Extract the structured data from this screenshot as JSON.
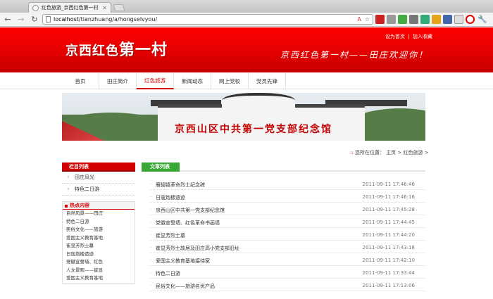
{
  "browser": {
    "tab_title": "红色旅游_京西红色第一村",
    "url_host": "localhost",
    "url_path": "/tianzhuang/a/hongselvyou/"
  },
  "site": {
    "logo_prefix": "京西红色",
    "logo_big": "第一村",
    "slogan": "京西红色第一村——田庄欢迎你！",
    "top_links": [
      "设为首页",
      "|",
      "加入收藏"
    ],
    "nav": [
      "首页",
      "田庄简介",
      "红色旅游",
      "新闻动态",
      "网上党校",
      "党员先锋"
    ],
    "active_nav": "红色旅游",
    "hero_text": "京西山区中共第一党支部纪念馆"
  },
  "breadcrumb": {
    "prefix": "您所在位置：",
    "home": "主页",
    "sep": ">",
    "current": "红色旅游",
    "tail": ">"
  },
  "sidebar": {
    "title": "栏目列表",
    "items": [
      "田庄风光",
      "特色二日游"
    ],
    "hot_title": "热点内容",
    "hot_items": [
      "自然风景——田庄",
      "特色二日游",
      "民俗文化——旅游",
      "爱国主义教育基地",
      "崔显芳烈士墓",
      "日寇炮楼遗迹",
      "党徽宣誓墙、红色",
      "人文景观——崔显",
      "爱国主义教育基地"
    ]
  },
  "content": {
    "title": "文章列表",
    "articles": [
      {
        "title": "雁翅镇革命烈士纪念碑",
        "date": "2011-09-11 17:46:46"
      },
      {
        "title": "日寇炮楼遗迹",
        "date": "2011-09-11 17:46:16"
      },
      {
        "title": "京西山区中共第一党支部纪念馆",
        "date": "2011-09-11 17:45:28"
      },
      {
        "title": "党徽宣誓墙、红色革命书画墙",
        "date": "2011-09-11 17:44:45"
      },
      {
        "title": "崔显芳烈士墓",
        "date": "2011-09-11 17:44:20"
      },
      {
        "title": "崔显芳烈士故居及田庄高小党支部旧址",
        "date": "2011-09-11 17:43:18"
      },
      {
        "title": "爱国主义教育基地接待室",
        "date": "2011-09-11 17:42:10"
      },
      {
        "title": "特色二日游",
        "date": "2011-09-11 17:33:44"
      },
      {
        "title": "民俗文化——旅游名优产品",
        "date": "2011-09-11 17:13:06"
      }
    ]
  },
  "icons": {
    "back": "back-arrow-icon",
    "forward": "forward-arrow-icon",
    "reload": "reload-icon",
    "star": "bookmark-star-icon",
    "wrench": "wrench-icon"
  },
  "colors": {
    "brand_red": "#e00000",
    "nav_active": "#dd0000",
    "content_green": "#3aa834"
  }
}
